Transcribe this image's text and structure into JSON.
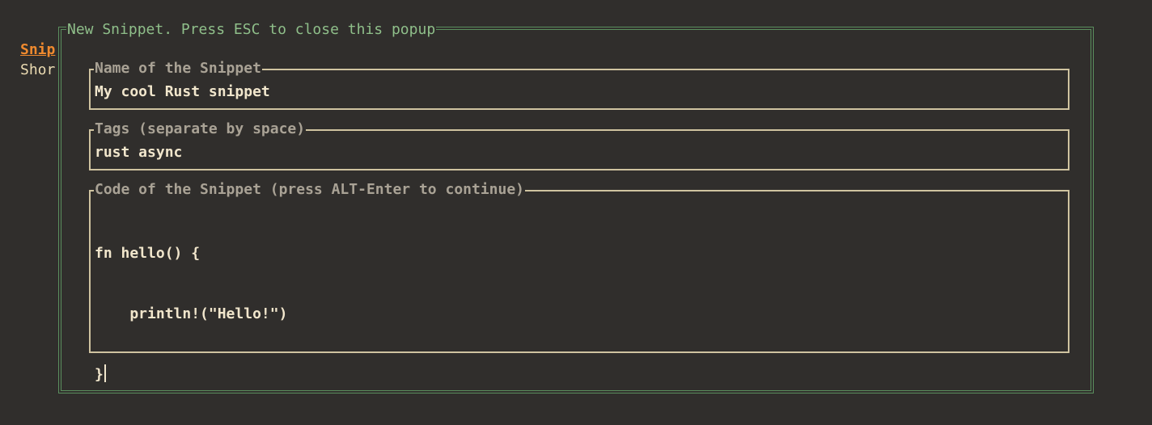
{
  "background": {
    "tab_label": "Snip",
    "sub_label": "Shor"
  },
  "popup": {
    "title": "New Snippet. Press ESC to close this popup",
    "fields": {
      "name": {
        "label": "Name of the Snippet",
        "value": "My cool Rust snippet"
      },
      "tags": {
        "label": "Tags (separate by space)",
        "value": "rust async"
      },
      "code": {
        "label": "Code of the Snippet (press ALT-Enter to continue)",
        "lines": [
          "fn hello() {",
          "    println!(\"Hello!\")",
          "}"
        ]
      }
    }
  },
  "colors": {
    "background": "#302e2c",
    "popup_border": "#5b8f5e",
    "popup_title": "#8fbf8a",
    "field_border": "#cfc3a0",
    "accent_orange": "#f08a2e",
    "text": "#f1e6cc"
  }
}
